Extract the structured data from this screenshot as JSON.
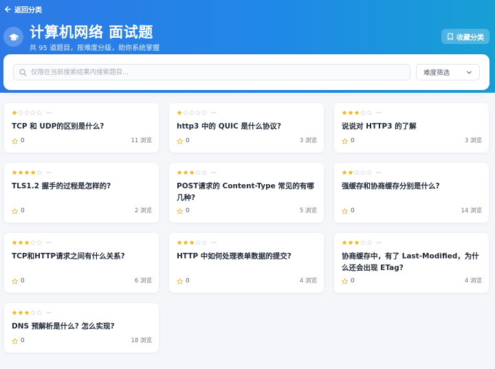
{
  "header": {
    "back_label": "返回分类",
    "title": "计算机网络 面试题",
    "subtitle": "共 95 道题目，按难度分级，助你系统掌握",
    "collect_label": "收藏分类"
  },
  "search": {
    "placeholder": "仅限在当前搜索结果内搜索题目...",
    "difficulty_label": "难度筛选"
  },
  "colors": {
    "star_filled": "#f5b417",
    "star_empty": "#d9dde3",
    "hero_start": "#2f79e6",
    "hero_end": "#18a0d4"
  },
  "questions": [
    {
      "title": "TCP 和 UDP的区别是什么?",
      "stars": 1,
      "likes": "0",
      "views": "11 浏览"
    },
    {
      "title": "http3 中的 QUIC 是什么协议?",
      "stars": 1,
      "likes": "0",
      "views": "3 浏览"
    },
    {
      "title": "说说对 HTTP3 的了解",
      "stars": 3,
      "likes": "0",
      "views": "3 浏览"
    },
    {
      "title": "TLS1.2 握手的过程是怎样的?",
      "stars": 4,
      "likes": "0",
      "views": "2 浏览"
    },
    {
      "title": "POST请求的 Content-Type 常见的有哪几种?",
      "stars": 3,
      "likes": "0",
      "views": "5 浏览"
    },
    {
      "title": "强缓存和协商缓存分别是什么?",
      "stars": 2,
      "likes": "0",
      "views": "14 浏览"
    },
    {
      "title": "TCP和HTTP请求之间有什么关系?",
      "stars": 3,
      "likes": "0",
      "views": "6 浏览"
    },
    {
      "title": "HTTP 中如何处理表单数据的提交?",
      "stars": 3,
      "likes": "0",
      "views": "4 浏览"
    },
    {
      "title": "协商缓存中，有了 Last-Modified，为什么还会出现 ETag?",
      "stars": 3,
      "likes": "0",
      "views": "4 浏览"
    },
    {
      "title": "DNS 预解析是什么? 怎么实现?",
      "stars": 3,
      "likes": "0",
      "views": "18 浏览"
    }
  ]
}
